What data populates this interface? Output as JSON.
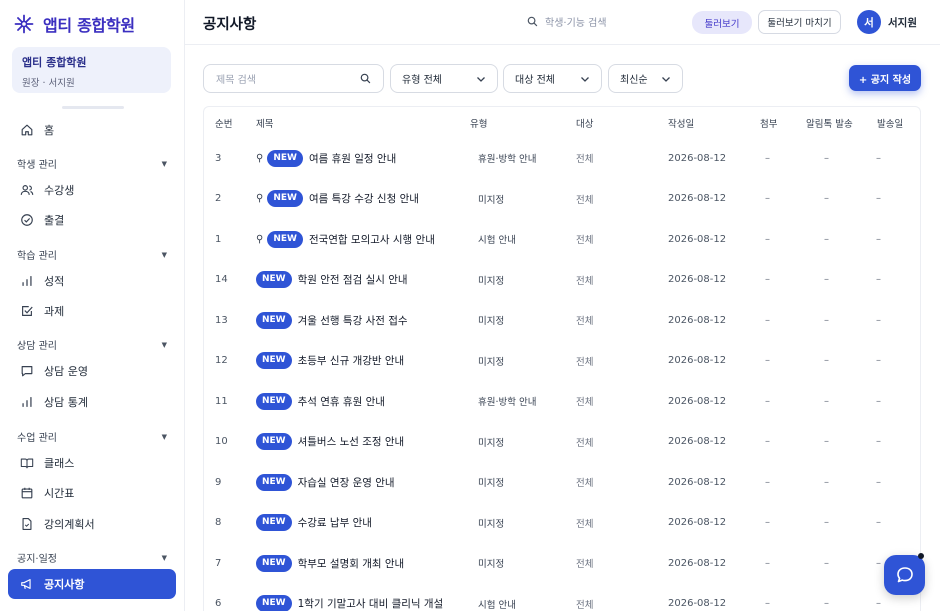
{
  "brand": {
    "name": "앱티 종합학원"
  },
  "org": {
    "name": "앱티 종합학원",
    "role": "원장 · 서지원"
  },
  "sidebar": {
    "home": "홈",
    "groups": [
      {
        "label": "학생 관리",
        "items": [
          "수강생",
          "출결"
        ]
      },
      {
        "label": "학습 관리",
        "items": [
          "성적",
          "과제"
        ]
      },
      {
        "label": "상담 관리",
        "items": [
          "상담 운영",
          "상담 통계"
        ]
      },
      {
        "label": "수업 관리",
        "items": [
          "클래스",
          "시간표",
          "강의계획서"
        ]
      },
      {
        "label": "공지·일정",
        "items": [
          "공지사항"
        ]
      }
    ]
  },
  "header": {
    "title": "공지사항",
    "search_placeholder": "학생·기능 검색",
    "preview_badge": "둘러보기",
    "end_preview": "둘러보기 마치기",
    "avatar_initial": "서",
    "user_name": "서지원"
  },
  "filters": {
    "search_placeholder": "제목 검색",
    "type": "유형 전체",
    "target": "대상 전체",
    "sort": "최신순",
    "create_button": "+ 공지 작성"
  },
  "table": {
    "columns": [
      "순번",
      "제목",
      "유형",
      "대상",
      "작성일",
      "첨부",
      "알림톡 발송",
      "발송일"
    ],
    "new_label": "NEW",
    "rows": [
      {
        "no": "3",
        "pinned": true,
        "title": "여름 휴원 일정 안내",
        "type": "휴원·방학 안내",
        "target": "전체",
        "date": "2026-08-12",
        "attach": "–",
        "kakao": "–",
        "sent": "–"
      },
      {
        "no": "2",
        "pinned": true,
        "title": "여름 특강 수강 신청 안내",
        "type": "미지정",
        "target": "전체",
        "date": "2026-08-12",
        "attach": "–",
        "kakao": "–",
        "sent": "–"
      },
      {
        "no": "1",
        "pinned": true,
        "title": "전국연합 모의고사 시행 안내",
        "type": "시험 안내",
        "target": "전체",
        "date": "2026-08-12",
        "attach": "–",
        "kakao": "–",
        "sent": "–"
      },
      {
        "no": "14",
        "pinned": false,
        "title": "학원 안전 점검 실시 안내",
        "type": "미지정",
        "target": "전체",
        "date": "2026-08-12",
        "attach": "–",
        "kakao": "–",
        "sent": "–"
      },
      {
        "no": "13",
        "pinned": false,
        "title": "겨울 선행 특강 사전 접수",
        "type": "미지정",
        "target": "전체",
        "date": "2026-08-12",
        "attach": "–",
        "kakao": "–",
        "sent": "–"
      },
      {
        "no": "12",
        "pinned": false,
        "title": "초등부 신규 개강반 안내",
        "type": "미지정",
        "target": "전체",
        "date": "2026-08-12",
        "attach": "–",
        "kakao": "–",
        "sent": "–"
      },
      {
        "no": "11",
        "pinned": false,
        "title": "추석 연휴 휴원 안내",
        "type": "휴원·방학 안내",
        "target": "전체",
        "date": "2026-08-12",
        "attach": "–",
        "kakao": "–",
        "sent": "–"
      },
      {
        "no": "10",
        "pinned": false,
        "title": "셔틀버스 노선 조정 안내",
        "type": "미지정",
        "target": "전체",
        "date": "2026-08-12",
        "attach": "–",
        "kakao": "–",
        "sent": "–"
      },
      {
        "no": "9",
        "pinned": false,
        "title": "자습실 연장 운영 안내",
        "type": "미지정",
        "target": "전체",
        "date": "2026-08-12",
        "attach": "–",
        "kakao": "–",
        "sent": "–"
      },
      {
        "no": "8",
        "pinned": false,
        "title": "수강료 납부 안내",
        "type": "미지정",
        "target": "전체",
        "date": "2026-08-12",
        "attach": "–",
        "kakao": "–",
        "sent": "–"
      },
      {
        "no": "7",
        "pinned": false,
        "title": "학부모 설명회 개최 안내",
        "type": "미지정",
        "target": "전체",
        "date": "2026-08-12",
        "attach": "–",
        "kakao": "–",
        "sent": "–"
      },
      {
        "no": "6",
        "pinned": false,
        "title": "1학기 기말고사 대비 클리닉 개설",
        "type": "시험 안내",
        "target": "전체",
        "date": "2026-08-12",
        "attach": "–",
        "kakao": "–",
        "sent": "–"
      }
    ]
  },
  "colors": {
    "accent": "#2f54d6",
    "brand": "#3b2fc0"
  }
}
